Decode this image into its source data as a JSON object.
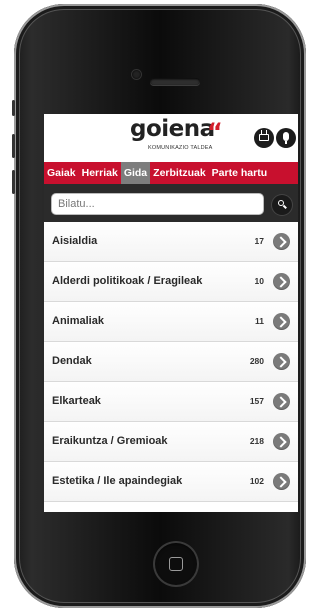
{
  "app": {
    "brand": "goiena",
    "brand_accent_quote": "“",
    "tagline": "KOMUNIKAZIO TALDEA",
    "colors": {
      "nav": "#c8102e",
      "accent": "#d21e2b",
      "active_tab": "#7d7d7d"
    }
  },
  "header_icons": [
    "tv-icon",
    "microphone-icon"
  ],
  "nav": {
    "items": [
      {
        "label": "Gaiak",
        "active": false
      },
      {
        "label": "Herriak",
        "active": false
      },
      {
        "label": "Gida",
        "active": true
      },
      {
        "label": "Zerbitzuak",
        "active": false
      },
      {
        "label": "Parte hartu",
        "active": false
      }
    ]
  },
  "search": {
    "placeholder": "Bilatu..."
  },
  "list": {
    "items": [
      {
        "label": "Aisialdia",
        "count": "17"
      },
      {
        "label": "Alderdi politikoak / Eragileak",
        "count": "10"
      },
      {
        "label": "Animaliak",
        "count": "11"
      },
      {
        "label": "Dendak",
        "count": "280"
      },
      {
        "label": "Elkarteak",
        "count": "157"
      },
      {
        "label": "Eraikuntza / Gremioak",
        "count": "218"
      },
      {
        "label": "Estetika / Ile apaindegiak",
        "count": "102"
      }
    ]
  }
}
